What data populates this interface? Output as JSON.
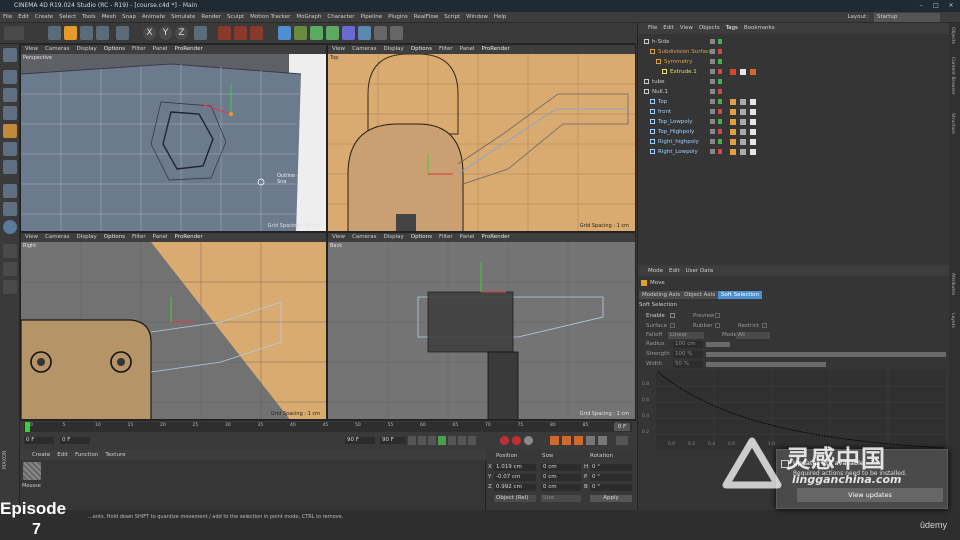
{
  "window": {
    "title": "CINEMA 4D R19.024 Studio (RC - R19) - [course.c4d *] - Main",
    "minimize_icon": "minimize-icon",
    "maximize_icon": "maximize-icon",
    "close_icon": "close-icon"
  },
  "menu": [
    "File",
    "Edit",
    "Create",
    "Select",
    "Tools",
    "Mesh",
    "Snap",
    "Animate",
    "Simulate",
    "Render",
    "Sculpt",
    "Motion Tracker",
    "MoGraph",
    "Character",
    "Pipeline",
    "Plugins",
    "RealFlow",
    "Script",
    "Window",
    "Help"
  ],
  "layout": {
    "label": "Layout:",
    "value": "Startup"
  },
  "toolbar": {
    "axis_x": "X",
    "axis_y": "Y",
    "axis_z": "Z"
  },
  "viewports": {
    "menu": [
      "View",
      "Cameras",
      "Display",
      "Options",
      "Filter",
      "Panel",
      "ProRender"
    ],
    "perspective": {
      "name": "Perspective",
      "grid": "Grid Spacing : 10 cm",
      "tooltip": "Outline - Vertex Sna"
    },
    "top": {
      "name": "Top",
      "grid": "Grid Spacing : 1 cm"
    },
    "right": {
      "name": "Right",
      "grid": "Grid Spacing : 1 cm"
    },
    "back": {
      "name": "Back",
      "grid": "Grid Spacing : 1 cm"
    }
  },
  "timeline": {
    "ticks": [
      "0",
      "5",
      "10",
      "15",
      "20",
      "25",
      "30",
      "35",
      "40",
      "45",
      "50",
      "55",
      "60",
      "65",
      "70",
      "75",
      "80",
      "85",
      "90"
    ],
    "current_frame": "0 F",
    "start_frame": "0 F",
    "end_frame": "90 F",
    "end_frame_2": "90 F",
    "frame_indicator": "0 F"
  },
  "material_manager": {
    "menu": [
      "Create",
      "Edit",
      "Function",
      "Texture"
    ],
    "material_name": "Mousse"
  },
  "coordinates": {
    "headers": [
      "Position",
      "Size",
      "Rotation"
    ],
    "rows": [
      {
        "axis": "X",
        "pos": "1.019 cm",
        "size": "0 cm",
        "rot_axis": "H",
        "rot": "0 °"
      },
      {
        "axis": "Y",
        "pos": "-0.07 cm",
        "size": "0 cm",
        "rot_axis": "P",
        "rot": "0 °"
      },
      {
        "axis": "Z",
        "pos": "0.992 cm",
        "size": "0 cm",
        "rot_axis": "B",
        "rot": "0 °"
      }
    ],
    "mode": "Object (Rel)",
    "size_mode": "Size",
    "apply": "Apply"
  },
  "object_manager": {
    "menu": [
      "File",
      "Edit",
      "View",
      "Objects",
      "Tags",
      "Bookmarks"
    ],
    "objects": [
      {
        "name": "h-Side",
        "indent": 0,
        "color": "#cfcfcf",
        "tags": []
      },
      {
        "name": "Subdivision Surface",
        "indent": 1,
        "color": "#d8a24a",
        "tags": []
      },
      {
        "name": "Symmetry",
        "indent": 2,
        "color": "#d8a24a",
        "tags": []
      },
      {
        "name": "Extrude.1",
        "indent": 3,
        "color": "#e8e06a",
        "tags": [
          "#d04a2a",
          "#e6e6e6",
          "#d46a2a"
        ]
      },
      {
        "name": "tube",
        "indent": 0,
        "color": "#cfcfcf",
        "tags": []
      },
      {
        "name": "Null.1",
        "indent": 0,
        "color": "#cfcfcf",
        "tags": []
      },
      {
        "name": "Top",
        "indent": 1,
        "color": "#9fd0ff",
        "tags": [
          "#e0a040",
          "#aaaaaa",
          "#e6e6e6"
        ]
      },
      {
        "name": "front",
        "indent": 1,
        "color": "#9fd0ff",
        "tags": [
          "#e0a040",
          "#aaaaaa",
          "#e6e6e6"
        ]
      },
      {
        "name": "Top_Lowpoly",
        "indent": 1,
        "color": "#9fd0ff",
        "tags": [
          "#e0a040",
          "#aaaaaa",
          "#e6e6e6"
        ]
      },
      {
        "name": "Top_Highpoly",
        "indent": 1,
        "color": "#9fd0ff",
        "tags": [
          "#e0a040",
          "#aaaaaa",
          "#e6e6e6"
        ]
      },
      {
        "name": "Right_highpoly",
        "indent": 1,
        "color": "#9fd0ff",
        "tags": [
          "#e0a040",
          "#aaaaaa",
          "#e6e6e6"
        ]
      },
      {
        "name": "Right_Lowpoly",
        "indent": 1,
        "color": "#9fd0ff",
        "tags": [
          "#e0a040",
          "#aaaaaa",
          "#e6e6e6"
        ]
      }
    ]
  },
  "attribute_manager": {
    "menu": [
      "Mode",
      "Edit",
      "User Data"
    ],
    "tool": "Move",
    "tabs": [
      "Modeling Axis",
      "Object Axis",
      "Soft Selection"
    ],
    "section": "Soft Selection",
    "enable_label": "Enable",
    "preview_label": "Preview",
    "surface_label": "Surface",
    "rubber_label": "Rubber",
    "restrict_label": "Restrict",
    "falloff_label": "Falloff",
    "falloff_value": "Linear",
    "mode_label": "Mode",
    "mode_value": "All",
    "radius_label": "Radius",
    "radius_value": "100 cm",
    "strength_label": "Strength",
    "strength_value": "100 %",
    "width_label": "Width",
    "width_value": "50 %",
    "graph_y": [
      "0.8",
      "0.6",
      "0.4",
      "0.2"
    ],
    "graph_x": [
      "0.0",
      "0.2",
      "0.4",
      "0.6",
      "0.8",
      "1.0"
    ]
  },
  "right_tabs": [
    "Objects",
    "Content Browser",
    "Structure",
    "Attributes",
    "Layers"
  ],
  "status_text": "...ents. Hold down SHIFT to quantize movement / add to the selection in point mode, CTRL to remove.",
  "episode": {
    "label": "Episode",
    "number": "7"
  },
  "update_popup": {
    "title": "Updates are available",
    "message": "Required actions need to be installed.",
    "button": "View updates"
  },
  "watermark": {
    "cn": "灵感中国",
    "site": "lingganchina.com"
  },
  "udemy": "ûdemy",
  "colors": {
    "accent": "#4d8fd1",
    "orange": "#e69a2a",
    "viewport_sky": "#d9ab70"
  }
}
